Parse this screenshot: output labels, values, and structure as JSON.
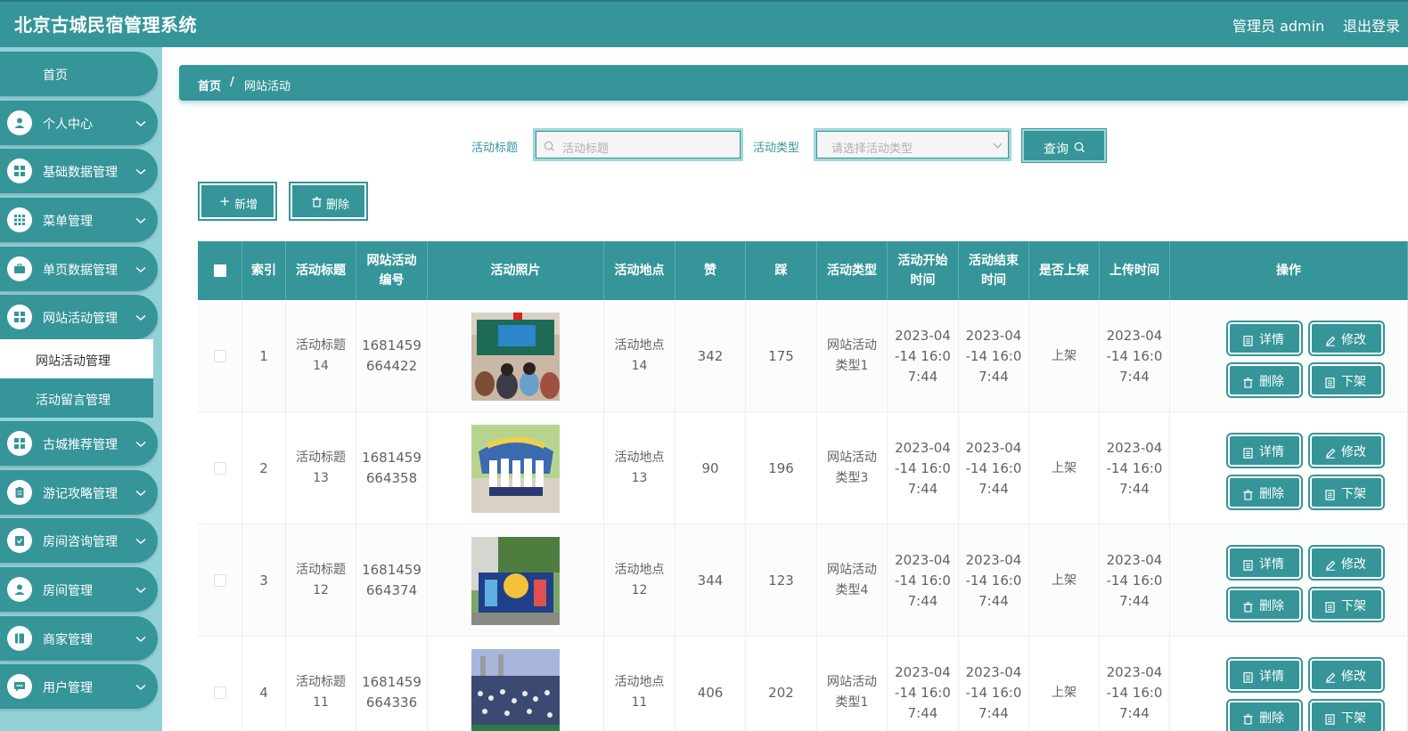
{
  "header": {
    "title": "北京古城民宿管理系统",
    "user": "管理员 admin",
    "logout": "退出登录"
  },
  "sidebar": {
    "home": "首页",
    "items": [
      {
        "label": "个人中心",
        "icon": "user-icon"
      },
      {
        "label": "基础数据管理",
        "icon": "grid-icon"
      },
      {
        "label": "菜单管理",
        "icon": "apps-icon"
      },
      {
        "label": "单页数据管理",
        "icon": "briefcase-icon"
      },
      {
        "label": "网站活动管理",
        "icon": "grid-icon"
      },
      {
        "label": "古城推荐管理",
        "icon": "grid-icon"
      },
      {
        "label": "游记攻略管理",
        "icon": "clipboard-icon"
      },
      {
        "label": "房间咨询管理",
        "icon": "checklist-icon"
      },
      {
        "label": "房间管理",
        "icon": "user-icon"
      },
      {
        "label": "商家管理",
        "icon": "book-icon"
      },
      {
        "label": "用户管理",
        "icon": "chat-icon"
      }
    ],
    "submenu": [
      {
        "label": "网站活动管理",
        "active": true
      },
      {
        "label": "活动留言管理",
        "active": false
      }
    ]
  },
  "breadcrumb": {
    "home": "首页",
    "separator": "/",
    "current": "网站活动"
  },
  "search": {
    "title_label": "活动标题",
    "title_placeholder": "活动标题",
    "type_label": "活动类型",
    "type_placeholder": "请选择活动类型",
    "query_button": "查询"
  },
  "actions": {
    "add": "新增",
    "delete": "删除"
  },
  "table": {
    "headers": [
      "索引",
      "活动标题",
      "网站活动编号",
      "活动照片",
      "活动地点",
      "赞",
      "踩",
      "活动类型",
      "活动开始时间",
      "活动结束时间",
      "是否上架",
      "上传时间",
      "操作"
    ],
    "header_lines": {
      "code": [
        "网站活动",
        "编号"
      ],
      "start": [
        "活动开始",
        "时间"
      ],
      "end": [
        "活动结束",
        "时间"
      ]
    },
    "rows": [
      {
        "index": "1",
        "title": [
          "活动标题",
          "14"
        ],
        "code": [
          "1681459",
          "664422"
        ],
        "location": [
          "活动地点",
          "14"
        ],
        "like": "342",
        "dislike": "175",
        "type": [
          "网站活动",
          "类型1"
        ],
        "start": [
          "2023-04",
          "-14 16:0",
          "7:44"
        ],
        "end": [
          "2023-04",
          "-14 16:0",
          "7:44"
        ],
        "onshelf": "上架",
        "upload": [
          "2023-04",
          "-14 16:0",
          "7:44"
        ]
      },
      {
        "index": "2",
        "title": [
          "活动标题",
          "13"
        ],
        "code": [
          "1681459",
          "664358"
        ],
        "location": [
          "活动地点",
          "13"
        ],
        "like": "90",
        "dislike": "196",
        "type": [
          "网站活动",
          "类型3"
        ],
        "start": [
          "2023-04",
          "-14 16:0",
          "7:44"
        ],
        "end": [
          "2023-04",
          "-14 16:0",
          "7:44"
        ],
        "onshelf": "上架",
        "upload": [
          "2023-04",
          "-14 16:0",
          "7:44"
        ]
      },
      {
        "index": "3",
        "title": [
          "活动标题",
          "12"
        ],
        "code": [
          "1681459",
          "664374"
        ],
        "location": [
          "活动地点",
          "12"
        ],
        "like": "344",
        "dislike": "123",
        "type": [
          "网站活动",
          "类型4"
        ],
        "start": [
          "2023-04",
          "-14 16:0",
          "7:44"
        ],
        "end": [
          "2023-04",
          "-14 16:0",
          "7:44"
        ],
        "onshelf": "上架",
        "upload": [
          "2023-04",
          "-14 16:0",
          "7:44"
        ]
      },
      {
        "index": "4",
        "title": [
          "活动标题",
          "11"
        ],
        "code": [
          "1681459",
          "664336"
        ],
        "location": [
          "活动地点",
          "11"
        ],
        "like": "406",
        "dislike": "202",
        "type": [
          "网站活动",
          "类型1"
        ],
        "start": [
          "2023-04",
          "-14 16:0",
          "7:44"
        ],
        "end": [
          "2023-04",
          "-14 16:0",
          "7:44"
        ],
        "onshelf": "上架",
        "upload": [
          "2023-04",
          "-14 16:0",
          "7:44"
        ]
      }
    ],
    "op_buttons": {
      "detail": "详情",
      "edit": "修改",
      "delete": "删除",
      "offshelf": "下架"
    }
  },
  "colors": {
    "primary": "#359599",
    "sidebar_bg": "#93d1d8",
    "input_glow": "#9fd6da"
  }
}
